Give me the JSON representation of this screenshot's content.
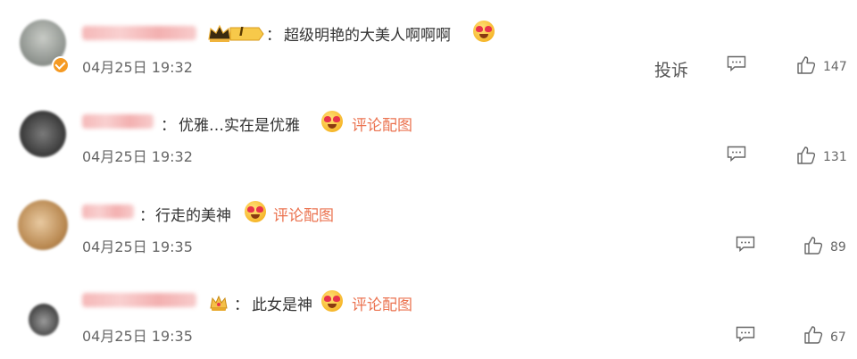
{
  "comments": [
    {
      "text": "超级明艳的大美人啊啊啊",
      "colon": "：",
      "time": "04月25日 19:32",
      "report": "投诉",
      "likes": "147",
      "badge": "I",
      "has_pic_link": false
    },
    {
      "text": "优雅…实在是优雅",
      "colon": "：",
      "time": "04月25日 19:32",
      "pic_link": "评论配图",
      "likes": "131"
    },
    {
      "text": "行走的美神",
      "colon": "：",
      "time": "04月25日 19:35",
      "pic_link": "评论配图",
      "likes": "89"
    },
    {
      "text": "此女是神",
      "colon": "：",
      "time": "04月25日 19:35",
      "pic_link": "评论配图",
      "likes": "67"
    }
  ],
  "colors": {
    "link": "#eb7350",
    "badge_gold": "#f0b43c",
    "verified": "#f59a23"
  },
  "icons": [
    "reply-icon",
    "like-icon",
    "crown-icon",
    "verified-icon",
    "heart-eyes-emoji"
  ]
}
